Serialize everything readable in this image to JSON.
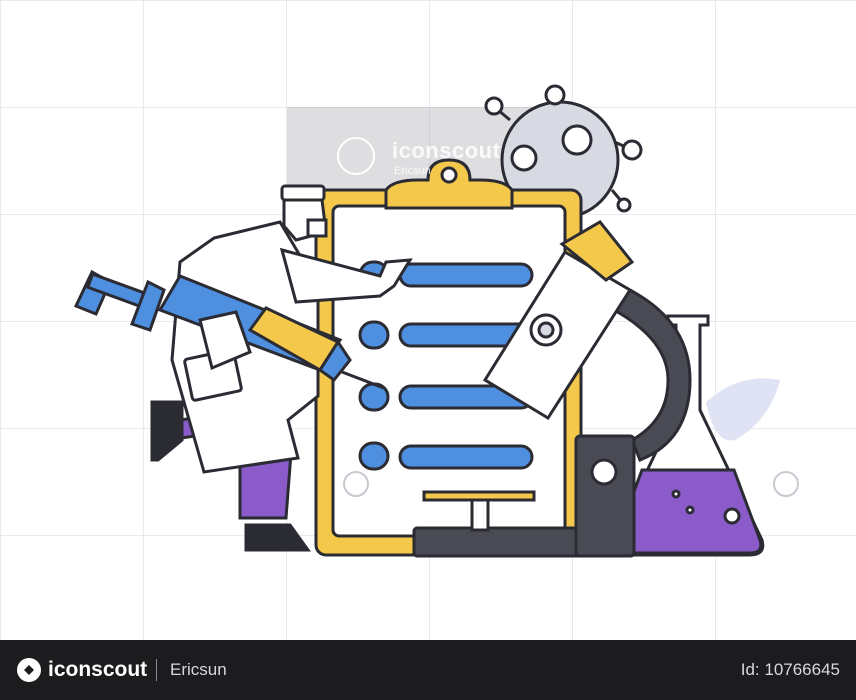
{
  "watermark": {
    "brand": "iconscout",
    "author": "Ericsun"
  },
  "footer": {
    "brand": "iconscout",
    "author": "Ericsun",
    "asset_id": "Id: 10766645"
  },
  "colors": {
    "outline": "#2b2b33",
    "blue": "#4f8fe0",
    "yellow": "#f3c84b",
    "purple": "#8a5bc9",
    "lavender": "#cdd3ef",
    "dark": "#4a4a55",
    "footer_bg": "#1c1c1e"
  }
}
